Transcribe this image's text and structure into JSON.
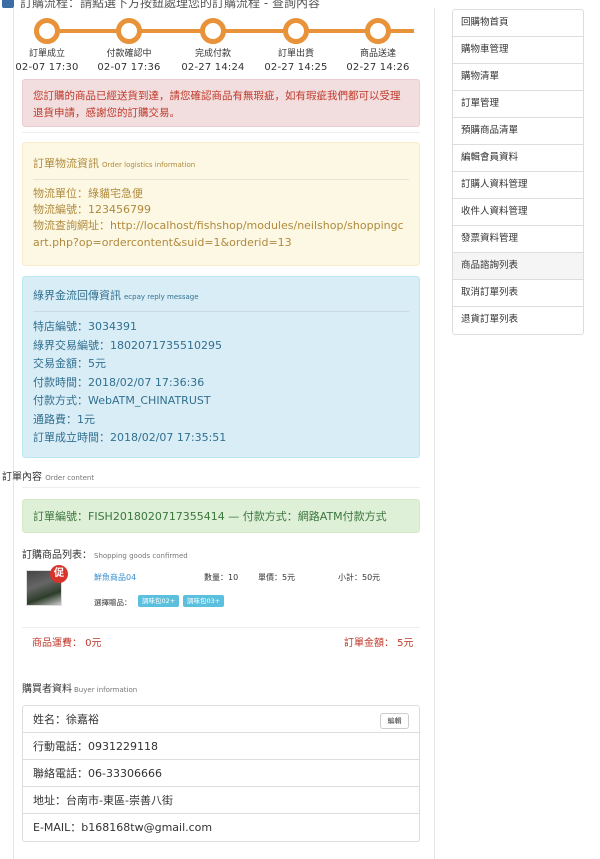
{
  "topbar": {
    "text": "訂購流程：請點選下方按鈕處理您的訂購流程 - 查詢內容"
  },
  "progress": {
    "steps": [
      {
        "label": "訂單成立",
        "time": "02-07 17:30"
      },
      {
        "label": "付款確認中",
        "time": "02-07 17:36"
      },
      {
        "label": "完成付款",
        "time": "02-27 14:24"
      },
      {
        "label": "訂單出貨",
        "time": "02-27 14:25"
      },
      {
        "label": "商品送達",
        "time": "02-27 14:26"
      }
    ]
  },
  "alert_message": "您訂購的商品已經送貨到達，請您確認商品有無瑕疵，如有瑕疵我們都可以受理退貨申請，感謝您的訂購交易。",
  "logistics": {
    "title": "訂單物流資訊",
    "title_en": "Order logistics information",
    "unit": "物流單位：綠貓宅急便",
    "number": "物流編號：123456799",
    "url": "物流查詢網址：http://localhost/fishshop/modules/neilshop/shoppingcart.php?op=ordercontent&suid=1&orderid=13"
  },
  "ecpay": {
    "title": "綠界金流回傳資訊",
    "title_en": "ecpay reply message",
    "rows": [
      "特店編號：3034391",
      "綠界交易編號：1802071735510295",
      "交易金額：5元",
      "付款時間：2018/02/07 17:36:36",
      "付款方式：WebATM_CHINATRUST",
      "通路費：1元",
      "訂單成立時間：2018/02/07 17:35:51"
    ]
  },
  "order_content": {
    "title": "訂單內容",
    "title_en": "Order content",
    "order_info": "訂單編號：FISH2018020717355414 — 付款方式：網路ATM付款方式"
  },
  "goods": {
    "title": "訂購商品列表：",
    "title_en": "Shopping goods confirmed",
    "items": [
      {
        "badge": "促",
        "name": "鮮魚商品04",
        "qty": "數量：10",
        "price": "單價：5元",
        "subtotal": "小計：50元",
        "option_label": "選擇贈品：",
        "options": [
          "調味包02+",
          "調味包03+"
        ]
      }
    ],
    "shipping": "商品運費： 0元",
    "total": "訂單金額： 5元"
  },
  "buyer": {
    "title": "購買者資料",
    "title_en": "Buyer information",
    "name": "姓名：徐嘉裕",
    "edit_label": "編輯",
    "mobile": "行動電話：0931229118",
    "phone": "聯絡電話：06-33306666",
    "address": "地址：台南市-東區-崇善八街",
    "email": "E-MAIL：b168168tw@gmail.com"
  },
  "sidebar": {
    "items": [
      {
        "label": "回購物首頁"
      },
      {
        "label": "購物車管理"
      },
      {
        "label": "購物清單"
      },
      {
        "label": "訂單管理"
      },
      {
        "label": "預購商品清單"
      },
      {
        "label": "編輯會員資料"
      },
      {
        "label": "訂購人資料管理"
      },
      {
        "label": "收件人資料管理"
      },
      {
        "label": "發票資料管理"
      },
      {
        "label": "商品諮詢列表"
      },
      {
        "label": "取消訂單列表"
      },
      {
        "label": "退貨訂單列表"
      }
    ],
    "active_index": 9
  },
  "colors": {
    "progress": "#e8923a",
    "danger": "#c0392b",
    "warning_bg": "#fcf8e3",
    "info_bg": "#d9edf7",
    "success_bg": "#dff0d8",
    "tag": "#5bc0de"
  }
}
